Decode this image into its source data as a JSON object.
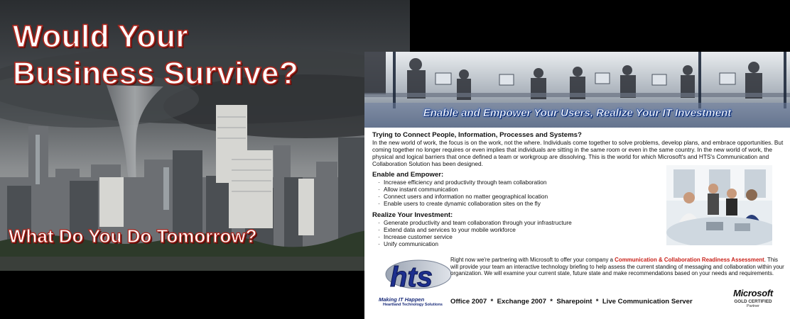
{
  "left_panel": {
    "headline_line1": "Would Your",
    "headline_line2": "Business Survive?",
    "tagline": "What Do You Do Tomorrow?"
  },
  "flyer": {
    "banner_title": "Enable and Empower Your Users, Realize Your IT Investment",
    "intro": {
      "heading": "Trying to Connect People, Information, Processes and Systems?",
      "text": "In the new world of work, the focus is on the work, not the where. Individuals come together to solve problems, develop plans, and embrace opportunities. But coming together no longer requires or even implies that individuals are sitting in the same room or even in the same country. In the new world of work, the physical and logical barriers that once defined a team or workgroup are dissolving. This is the world for which Microsoft's and HTS's Communication and Collaboration Solution has been designed."
    },
    "enable": {
      "heading": "Enable and Empower:",
      "items": [
        "Increase efficiency and productivity through team collaboration",
        "Allow instant communication",
        "Connect users and information no matter geographical location",
        "Enable users to create dynamic collaboration sites on the fly"
      ]
    },
    "realize": {
      "heading": "Realize Your Investment:",
      "items": [
        "Generate productivity and team collaboration through your infrastructure",
        "Extend data and services to your mobile workforce",
        "Increase customer service",
        "Unify communication"
      ]
    },
    "cta": {
      "before": "Right now we're partnering with Microsoft to offer your company a ",
      "highlight": "Communication & Collaboration Readiness Assessment",
      "after": ". This will provide your team an interactive technology briefing to help assess the current standing of messaging and collaboration within your organization. We will examine your current state, future state and make recommendations based on your needs and requirements."
    },
    "logo": {
      "letters": "hts",
      "tagline": "Making IT Happen",
      "company": "Heartland Technology Solutions"
    },
    "products": "Office 2007  *  Exchange 2007  *  Sharepoint  *  Live Communication Server",
    "partner": {
      "brand": "Microsoft",
      "level": "GOLD CERTIFIED",
      "label": "Partner"
    }
  },
  "colors": {
    "headline_outline": "#b0281f",
    "banner_text_glow": "#3b6fd6",
    "cta_highlight": "#c8241c",
    "logo_blue": "#1a2c7a"
  }
}
